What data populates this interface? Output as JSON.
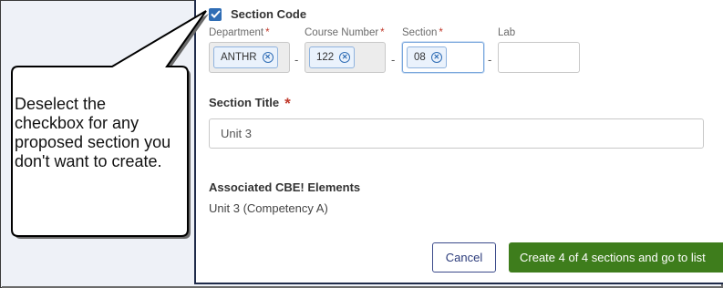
{
  "form": {
    "section_code_label": "Section Code",
    "section_code_checked": true,
    "fields": {
      "department": {
        "label": "Department",
        "value": "ANTHR"
      },
      "course_number": {
        "label": "Course Number",
        "value": "122"
      },
      "section": {
        "label": "Section",
        "value": "08"
      },
      "lab": {
        "label": "Lab",
        "value": ""
      }
    },
    "required_mark": "*",
    "separator": "-",
    "section_title_label": "Section Title",
    "section_title_value": "Unit 3",
    "cbe_heading": "Associated CBE! Elements",
    "cbe_item": "Unit 3 (Competency A)"
  },
  "buttons": {
    "cancel": "Cancel",
    "create": "Create 4 of 4 sections and go to list"
  },
  "callout": {
    "text": "Deselect the checkbox for any proposed section you don't want to create."
  },
  "colors": {
    "checkbox": "#2f6db5",
    "required": "#c0392b",
    "create_button": "#3e7d1c",
    "cancel_border": "#3b4a8a",
    "chip_border": "#8fb3de"
  },
  "icons": {
    "checkbox": "check-icon",
    "chip_remove": "circle-x-icon"
  }
}
